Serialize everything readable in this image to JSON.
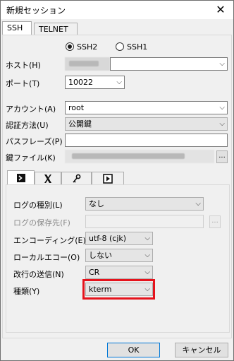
{
  "window": {
    "title": "新規セッション",
    "close_glyph": "✕"
  },
  "tabs": [
    {
      "label": "SSH"
    },
    {
      "label": "TELNET"
    }
  ],
  "protocol": {
    "options": [
      {
        "label": "SSH2",
        "selected": true
      },
      {
        "label": "SSH1",
        "selected": false
      }
    ]
  },
  "host": {
    "label": "ホスト(H)"
  },
  "port": {
    "label": "ポート(T)",
    "value": "10022"
  },
  "account": {
    "label": "アカウント(A)",
    "value": "root"
  },
  "auth": {
    "label": "認証方法(U)",
    "value": "公開鍵"
  },
  "passphrase": {
    "label": "パスフレーズ(P)",
    "value": ""
  },
  "keyfile": {
    "label": "鍵ファイル(K)",
    "browse": "..."
  },
  "inner_tabs": [
    {
      "icon": "terminal-icon",
      "glyph": "⮞"
    },
    {
      "icon": "x-window-icon",
      "glyph": "X"
    },
    {
      "icon": "key-icon",
      "glyph": "⚷"
    },
    {
      "icon": "play-box-icon",
      "glyph": "▶"
    }
  ],
  "terminal": {
    "log_type": {
      "label": "ログの種別(L)",
      "value": "なし"
    },
    "log_path": {
      "label": "ログの保存先(F)",
      "value": "",
      "browse": "..."
    },
    "encoding": {
      "label": "エンコーディング(E)",
      "value": "utf-8 (cjk)"
    },
    "local_echo": {
      "label": "ローカルエコー(O)",
      "value": "しない"
    },
    "newline": {
      "label": "改行の送信(N)",
      "value": "CR"
    },
    "term_type": {
      "label": "種類(Y)",
      "value": "kterm"
    }
  },
  "buttons": {
    "ok": "OK",
    "cancel": "キャンセル"
  },
  "colors": {
    "highlight": "#e5131c",
    "default_button_border": "#0078d7"
  }
}
